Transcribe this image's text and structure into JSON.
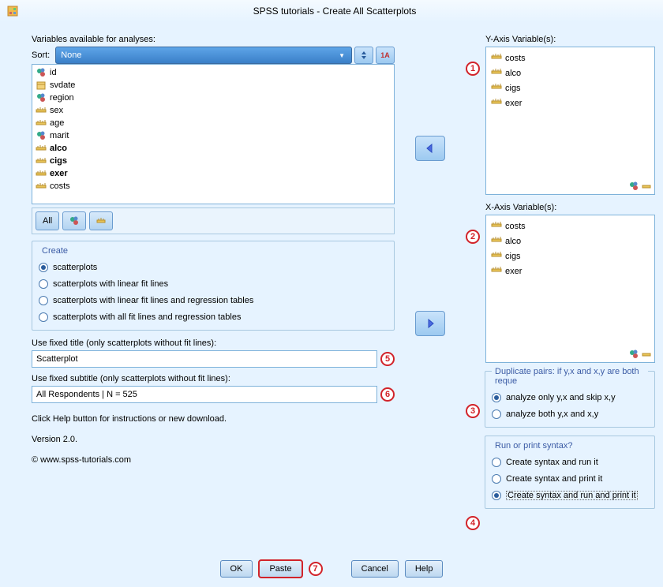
{
  "window": {
    "title": "SPSS tutorials - Create All Scatterplots"
  },
  "available_label": "Variables available for analyses:",
  "sort_label": "Sort:",
  "sort_value": "None",
  "filter_all": "All",
  "variables": [
    {
      "name": "id",
      "icon": "nom",
      "bold": false
    },
    {
      "name": "svdate",
      "icon": "date",
      "bold": false
    },
    {
      "name": "region",
      "icon": "nom",
      "bold": false
    },
    {
      "name": "sex",
      "icon": "scale",
      "bold": false
    },
    {
      "name": "age",
      "icon": "scale",
      "bold": false
    },
    {
      "name": "marit",
      "icon": "nom",
      "bold": false
    },
    {
      "name": "alco",
      "icon": "scale",
      "bold": true
    },
    {
      "name": "cigs",
      "icon": "scale",
      "bold": true
    },
    {
      "name": "exer",
      "icon": "scale",
      "bold": true
    },
    {
      "name": "costs",
      "icon": "scale",
      "bold": false
    }
  ],
  "create": {
    "legend": "Create",
    "options": [
      {
        "label": "scatterplots",
        "checked": true
      },
      {
        "label": "scatterplots with linear fit lines",
        "checked": false
      },
      {
        "label": "scatterplots with linear fit lines and regression tables",
        "checked": false
      },
      {
        "label": "scatterplots with all fit lines and regression tables",
        "checked": false
      }
    ]
  },
  "title_label": "Use fixed title (only scatterplots without fit lines):",
  "title_value": "Scatterplot",
  "title_callout": "5",
  "subtitle_label": "Use fixed subtitle (only scatterplots without fit lines):",
  "subtitle_value": "All Respondents | N = 525",
  "subtitle_callout": "6",
  "help_hint": "Click Help button for instructions or new download.",
  "version": "Version 2.0.",
  "copyright": "© www.spss-tutorials.com",
  "yaxis": {
    "label": "Y-Axis Variable(s):",
    "callout": "1",
    "vars": [
      {
        "name": "costs",
        "icon": "scale"
      },
      {
        "name": "alco",
        "icon": "scale"
      },
      {
        "name": "cigs",
        "icon": "scale"
      },
      {
        "name": "exer",
        "icon": "scale"
      }
    ]
  },
  "xaxis": {
    "label": "X-Axis Variable(s):",
    "callout": "2",
    "vars": [
      {
        "name": "costs",
        "icon": "scale"
      },
      {
        "name": "alco",
        "icon": "scale"
      },
      {
        "name": "cigs",
        "icon": "scale"
      },
      {
        "name": "exer",
        "icon": "scale"
      }
    ]
  },
  "dup": {
    "legend": "Duplicate pairs: if y,x and x,y are both reque",
    "callout": "3",
    "options": [
      {
        "label": "analyze only y,x and skip x,y",
        "checked": true
      },
      {
        "label": "analyze both y,x and x,y",
        "checked": false
      }
    ]
  },
  "run": {
    "legend": "Run or print syntax?",
    "callout": "4",
    "options": [
      {
        "label": "Create syntax and run it",
        "checked": false
      },
      {
        "label": "Create syntax and print it",
        "checked": false
      },
      {
        "label": "Create syntax and run and print it",
        "checked": true
      }
    ]
  },
  "buttons": {
    "ok": "OK",
    "paste": "Paste",
    "cancel": "Cancel",
    "help": "Help",
    "paste_callout": "7"
  }
}
